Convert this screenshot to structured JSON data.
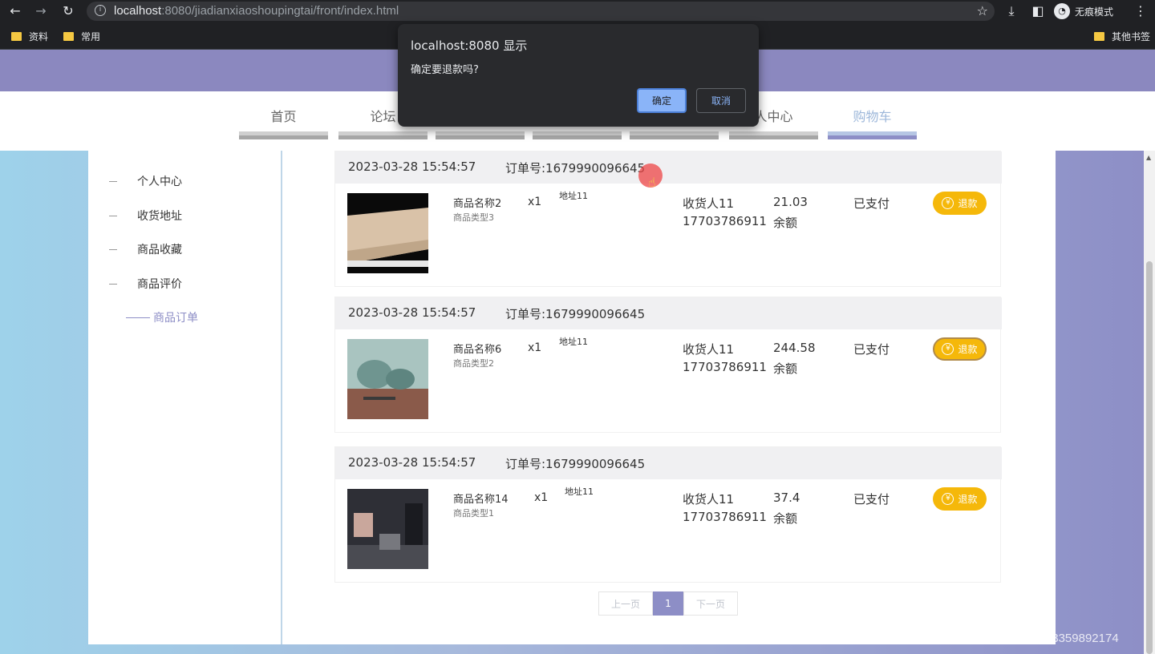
{
  "browser": {
    "url_host": "localhost",
    "url_rest": ":8080/jiadianxiaoshoupingtai/front/index.html",
    "profile_label": "无痕模式",
    "bookmarks": [
      "资料",
      "常用"
    ],
    "other_bookmarks": "其他书签"
  },
  "nav": {
    "items": [
      "首页",
      "论坛",
      "",
      "",
      "",
      "人中心",
      "购物车"
    ]
  },
  "sidebar": {
    "items": [
      "个人中心",
      "收货地址",
      "商品收藏",
      "商品评价"
    ],
    "active": "商品订单"
  },
  "orders": [
    {
      "time": "2023-03-28 15:54:57",
      "order_no": "订单号:1679990096645",
      "name": "商品名称2",
      "type": "商品类型3",
      "qty": "x1",
      "address": "地址11",
      "receiver": "收货人11",
      "phone": "17703786911",
      "price": "21.03",
      "pay_method": "余额",
      "status": "已支付",
      "refund": "退款"
    },
    {
      "time": "2023-03-28 15:54:57",
      "order_no": "订单号:1679990096645",
      "name": "商品名称6",
      "type": "商品类型2",
      "qty": "x1",
      "address": "地址11",
      "receiver": "收货人11",
      "phone": "17703786911",
      "price": "244.58",
      "pay_method": "余额",
      "status": "已支付",
      "refund": "退款"
    },
    {
      "time": "2023-03-28 15:54:57",
      "order_no": "订单号:1679990096645",
      "name": "商品名称14",
      "type": "商品类型1",
      "qty": "x1",
      "address": "地址11",
      "receiver": "收货人11",
      "phone": "17703786911",
      "price": "37.4",
      "pay_method": "余额",
      "status": "已支付",
      "refund": "退款"
    }
  ],
  "pagination": {
    "prev": "上一页",
    "current": "1",
    "next": "下一页"
  },
  "dialog": {
    "title": "localhost:8080 显示",
    "message": "确定要退款吗?",
    "ok": "确定",
    "cancel": "取消"
  },
  "watermark": "CSDN @QQ3359892174",
  "colors": {
    "accent": "#8d8ec6",
    "refund": "#f5b80a",
    "dialog_bg": "#292a2d"
  }
}
